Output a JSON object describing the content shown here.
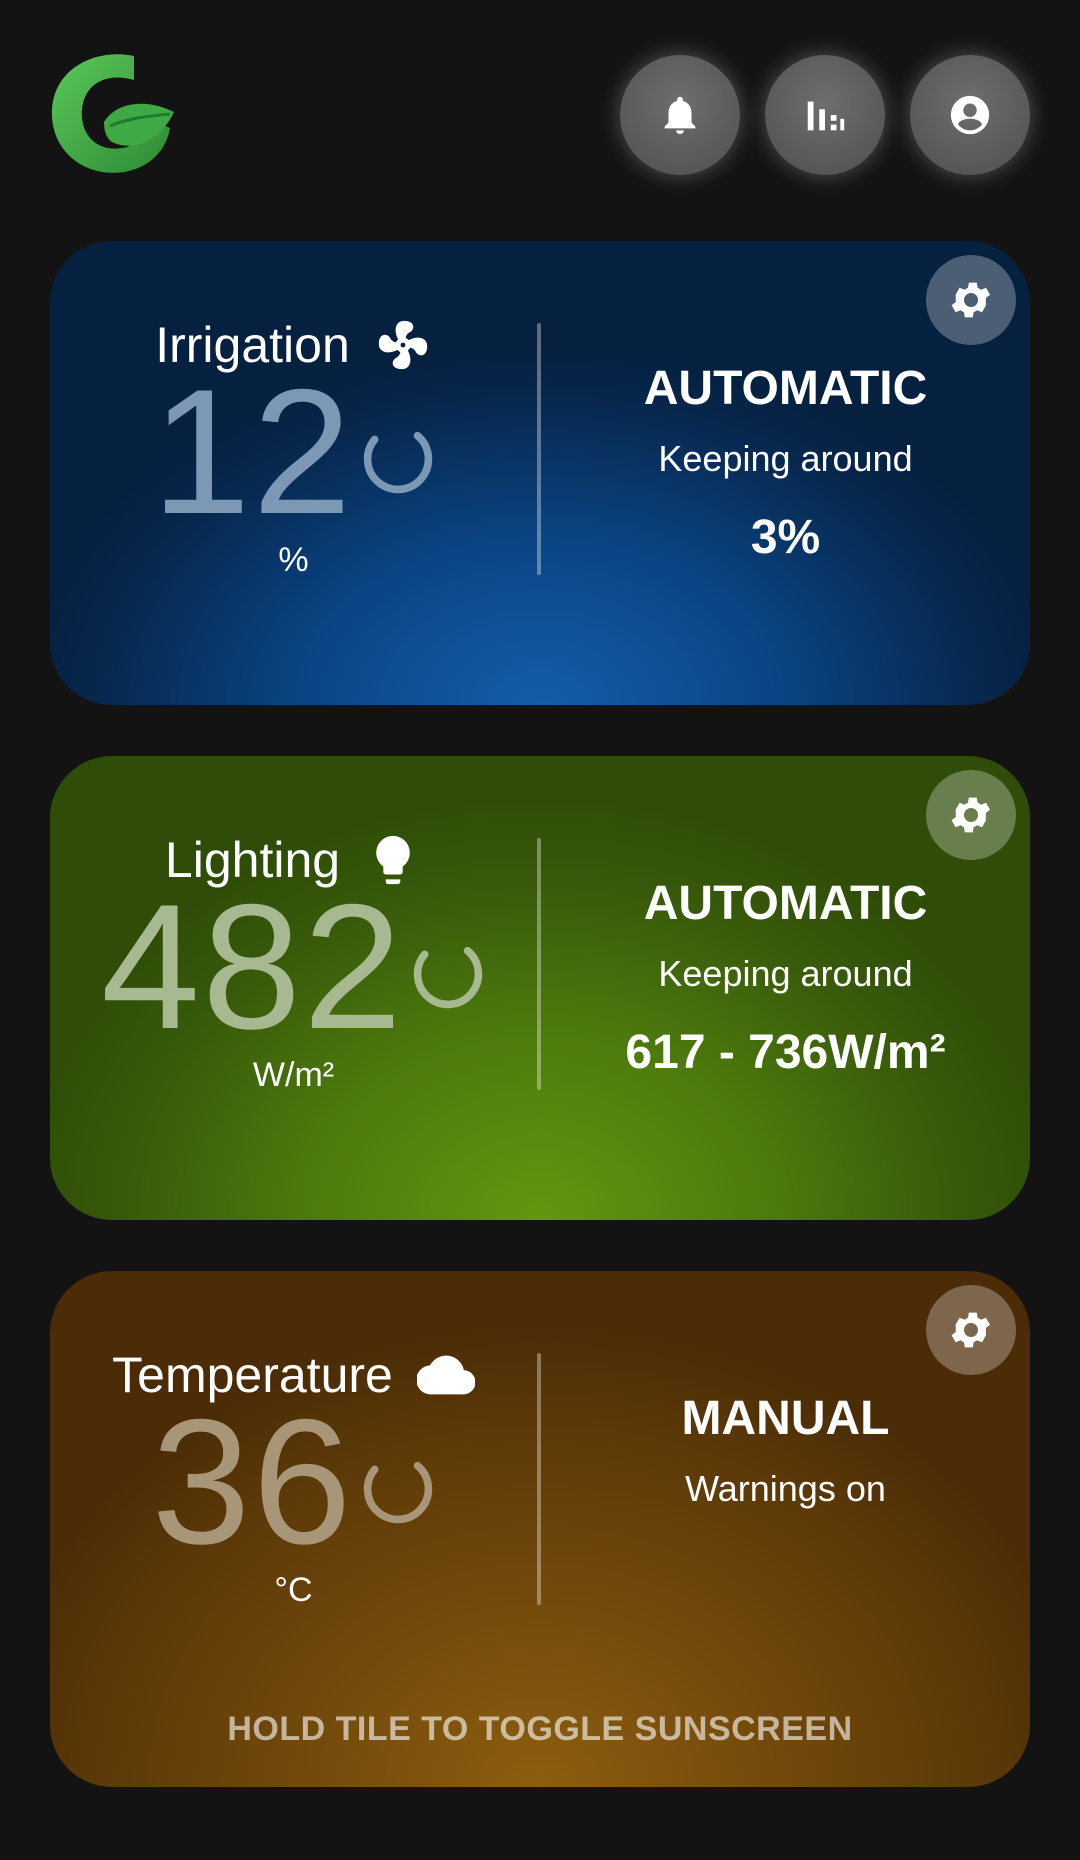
{
  "header": {
    "logo_icon": "app-logo-leaf",
    "buttons": [
      {
        "icon": "bell-icon",
        "label": "notifications"
      },
      {
        "icon": "bar-chart-icon",
        "label": "statistics"
      },
      {
        "icon": "account-icon",
        "label": "profile"
      }
    ]
  },
  "tiles": [
    {
      "title": "Irrigation",
      "icon": "fan-icon",
      "value": "12",
      "unit": "%",
      "mode": "AUTOMATIC",
      "mode_subtitle": "Keeping around",
      "target": "3%",
      "color": "#0a4585",
      "value_color": "#7d98b5"
    },
    {
      "title": "Lighting",
      "icon": "lightbulb-icon",
      "value": "482",
      "unit": "W/m²",
      "mode": "AUTOMATIC",
      "mode_subtitle": "Keeping around",
      "target": "617 - 736W/m²",
      "color": "#4d7a0d",
      "value_color": "#a7b991"
    },
    {
      "title": "Temperature",
      "icon": "cloud-icon",
      "value": "36",
      "unit": "°C",
      "mode": "MANUAL",
      "mode_subtitle": "Warnings on",
      "target": "",
      "hint": "HOLD TILE TO TOGGLE SUNSCREEN",
      "color": "#71480b",
      "value_color": "#a99679"
    }
  ]
}
